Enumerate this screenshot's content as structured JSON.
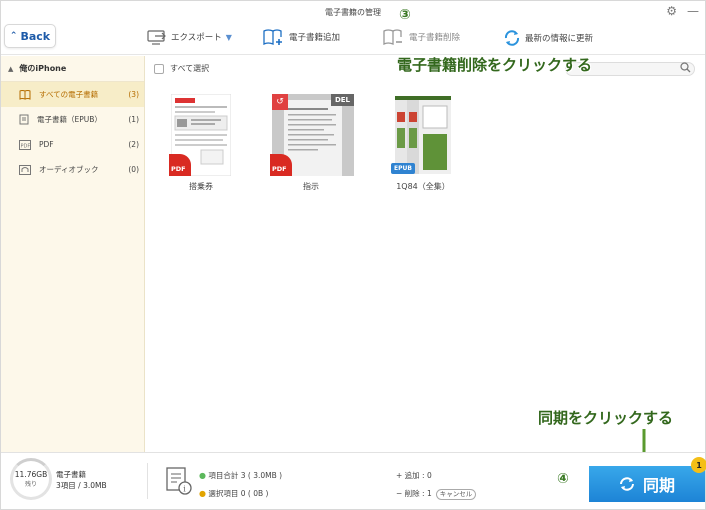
{
  "window": {
    "title": "電子書籍の管理"
  },
  "toolbar": {
    "back_label": "Back",
    "export_label": "エクスポート",
    "add_label": "電子書籍追加",
    "delete_label": "電子書籍削除",
    "refresh_label": "最新の情報に更新"
  },
  "sidebar": {
    "device_name": "俺のiPhone",
    "items": [
      {
        "label": "すべての電子書籍",
        "count": "(3)"
      },
      {
        "label": "電子書籍（EPUB）",
        "count": "(1)"
      },
      {
        "label": "PDF",
        "count": "(2)"
      },
      {
        "label": "オーディオブック",
        "count": "(0)"
      }
    ]
  },
  "main": {
    "select_all_label": "すべて選択",
    "books": [
      {
        "title": "搭乗券",
        "badge": "PDF"
      },
      {
        "title": "指示",
        "badge": "PDF",
        "del_badge": "DEL"
      },
      {
        "title": "1Q84（全集）",
        "badge": "EPUB"
      }
    ]
  },
  "annotations": {
    "step3_number": "③",
    "step3_text": "電子書籍削除をクリックする",
    "step4_number": "④",
    "step4_text": "同期をクリックする"
  },
  "bottom": {
    "storage_value": "11.76GB",
    "storage_label": "残り",
    "category_name": "電子書籍",
    "category_summary": "3項目 / 3.0MB",
    "total_items": "項目合計 3 ( 3.0MB )",
    "selected_items": "選択項目 0 ( 0B )",
    "added": "+ 追加 : 0",
    "deleted": "− 削除 : 1",
    "cancel_label": "キャンセル",
    "sync_label": "同期",
    "sync_badge": "1"
  },
  "colors": {
    "accent": "#1d84d6",
    "sidebar_bg": "#fdf8ea",
    "annotation_green": "#33681d",
    "pdf_red": "#d92a22"
  }
}
